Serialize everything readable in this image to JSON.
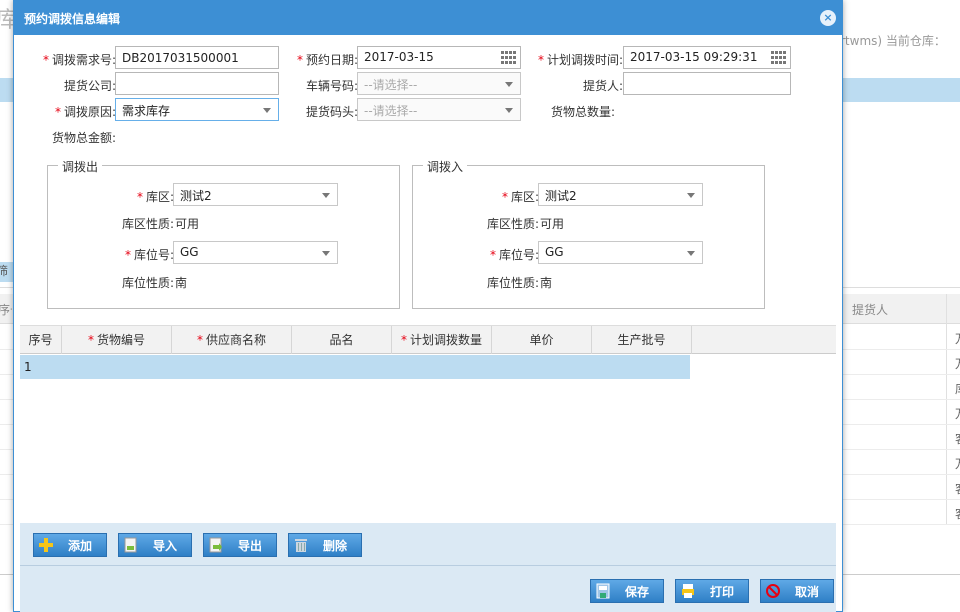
{
  "background": {
    "title_char": "库",
    "info_text": "rtwms) 当前仓库：",
    "tab_chip": "筛",
    "colhead_left": "序号",
    "colhead_right": "提货人",
    "row_cells": [
      "万",
      "万",
      "库",
      "万",
      "客",
      "万",
      "客",
      "客"
    ]
  },
  "dialog": {
    "title": "预约调拨信息编辑",
    "close_glyph": "×"
  },
  "form": {
    "request_no": {
      "label": "调拨需求号:",
      "value": "DB2017031500001"
    },
    "appoint_date": {
      "label": "预约日期:",
      "value": "2017-03-15"
    },
    "plan_time": {
      "label": "计划调拨时间:",
      "value": "2017-03-15 09:29:31"
    },
    "pickup_company": {
      "label": "提货公司:",
      "value": ""
    },
    "vehicle_no": {
      "label": "车辆号码:",
      "value": "--请选择--"
    },
    "pickup_person": {
      "label": "提货人:",
      "value": ""
    },
    "reason": {
      "label": "调拨原因:",
      "value": "需求库存"
    },
    "dock": {
      "label": "提货码头:",
      "value": "--请选择--"
    },
    "total_qty": {
      "label": "货物总数量:",
      "value": ""
    },
    "total_amount": {
      "label": "货物总金额:",
      "value": ""
    }
  },
  "transfer_out": {
    "legend": "调拨出",
    "zone_label": "库区:",
    "zone_value": "测试2",
    "zone_prop_label": "库区性质:",
    "zone_prop_value": "可用",
    "loc_label": "库位号:",
    "loc_value": "GG",
    "loc_prop_label": "库位性质:",
    "loc_prop_value": "南"
  },
  "transfer_in": {
    "legend": "调拨入",
    "zone_label": "库区:",
    "zone_value": "测试2",
    "zone_prop_label": "库区性质:",
    "zone_prop_value": "可用",
    "loc_label": "库位号:",
    "loc_value": "GG",
    "loc_prop_label": "库位性质:",
    "loc_prop_value": "南"
  },
  "grid": {
    "columns": [
      {
        "label": "序号",
        "required": false
      },
      {
        "label": "货物编号",
        "required": true
      },
      {
        "label": "供应商名称",
        "required": true
      },
      {
        "label": "品名",
        "required": false
      },
      {
        "label": "计划调拨数量",
        "required": true
      },
      {
        "label": "单价",
        "required": false
      },
      {
        "label": "生产批号",
        "required": false
      }
    ],
    "rows": [
      {
        "index": "1"
      }
    ]
  },
  "toolbar": {
    "add": "添加",
    "import": "导入",
    "export": "导出",
    "delete": "删除"
  },
  "footer": {
    "save": "保存",
    "print": "打印",
    "cancel": "取消"
  },
  "colors": {
    "title_bar": "#3d8fd4",
    "button": "#2f7fc6",
    "required": "#e60012",
    "selected_row": "#bcdcf1",
    "toolbar_bg": "#dbe9f4"
  }
}
